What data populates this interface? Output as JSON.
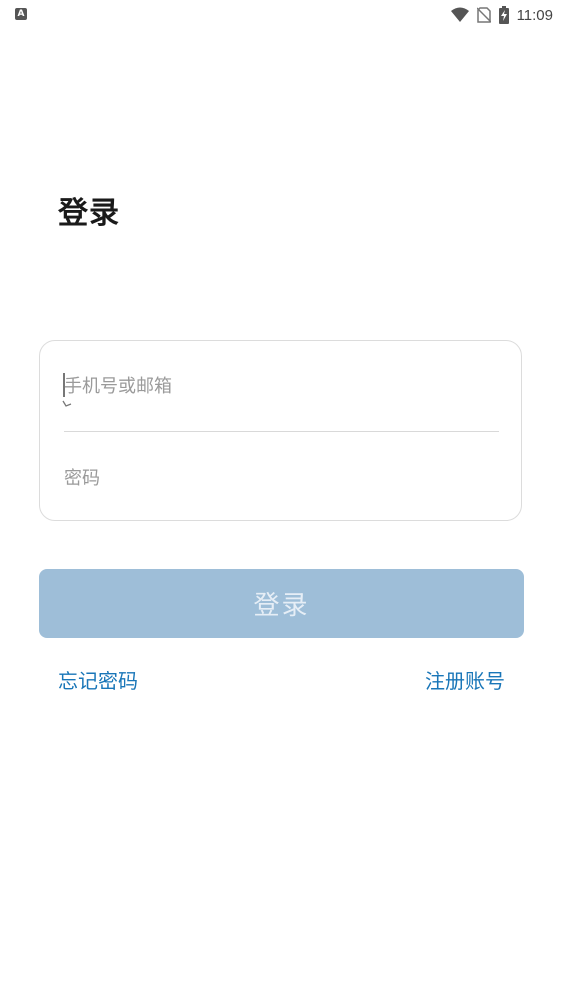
{
  "status_bar": {
    "left_badge": "A",
    "time": "11:09",
    "icons": [
      "wifi-icon",
      "no-sim-icon",
      "battery-charging-icon"
    ]
  },
  "page": {
    "title": "登录"
  },
  "form": {
    "account_placeholder": "手机号或邮箱",
    "account_value": "",
    "password_placeholder": "密码",
    "password_value": ""
  },
  "actions": {
    "login_label": "登录",
    "forgot_label": "忘记密码",
    "register_label": "注册账号"
  },
  "colors": {
    "button_disabled": "#9ebed8",
    "link": "#1976b8"
  }
}
